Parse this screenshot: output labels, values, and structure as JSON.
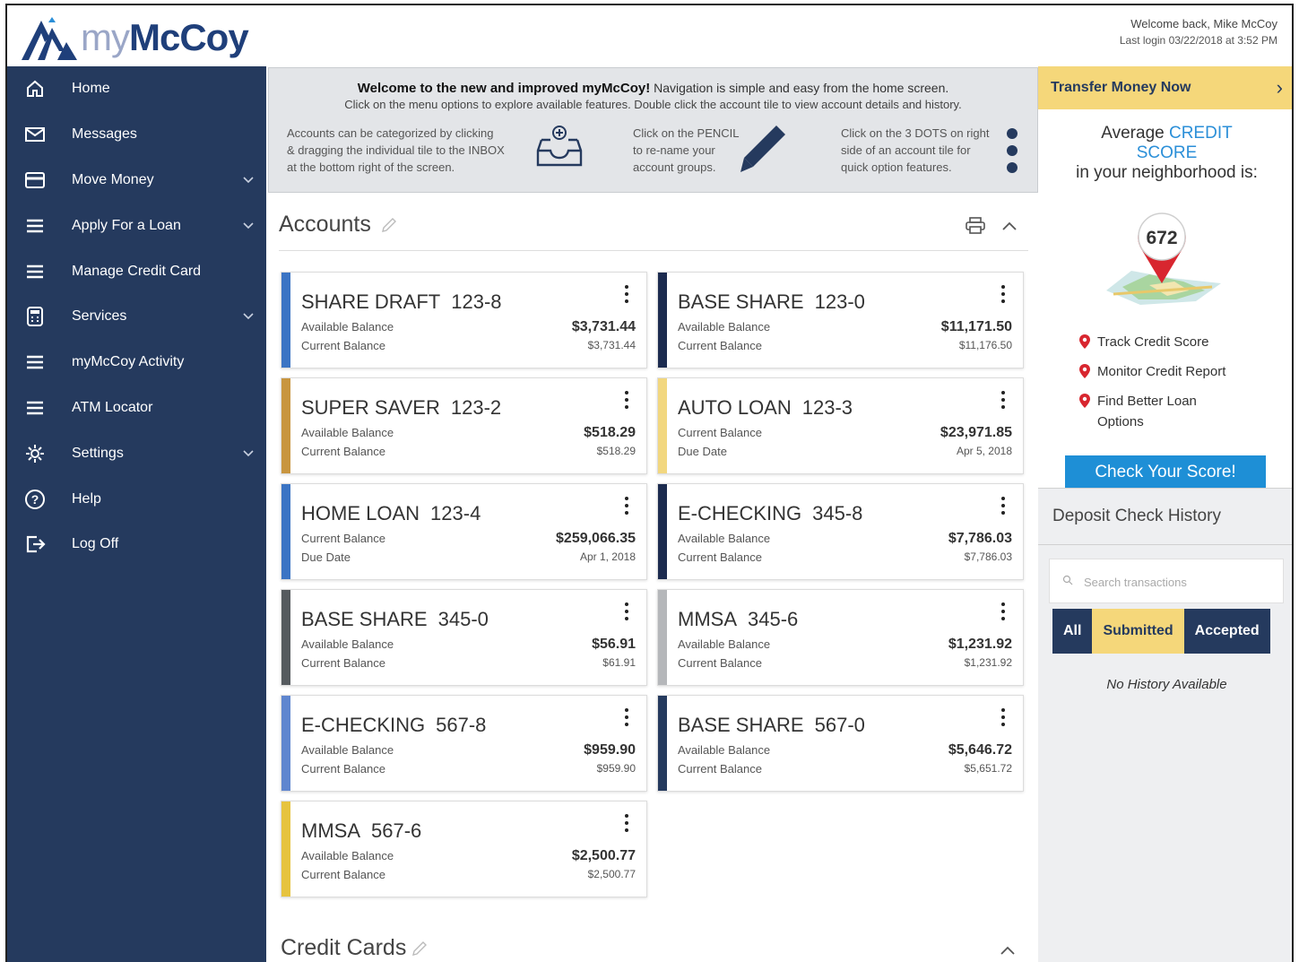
{
  "brand": {
    "logo_my": "my",
    "logo_mc": "McCoy"
  },
  "header": {
    "welcome": "Welcome back, Mike McCoy",
    "last_login": "Last login 03/22/2018 at 3:52 PM"
  },
  "sidebar": {
    "items": [
      {
        "label": "Home",
        "icon": "home-icon",
        "has_chevron": false
      },
      {
        "label": "Messages",
        "icon": "envelope-icon",
        "has_chevron": false
      },
      {
        "label": "Move Money",
        "icon": "card-icon",
        "has_chevron": true
      },
      {
        "label": "Apply For a Loan",
        "icon": "menu-icon",
        "has_chevron": true
      },
      {
        "label": "Manage Credit Card",
        "icon": "menu-icon",
        "has_chevron": false
      },
      {
        "label": "Services",
        "icon": "calculator-icon",
        "has_chevron": true
      },
      {
        "label": "myMcCoy Activity",
        "icon": "menu-icon",
        "has_chevron": false
      },
      {
        "label": "ATM Locator",
        "icon": "menu-icon",
        "has_chevron": false
      },
      {
        "label": "Settings",
        "icon": "gear-icon",
        "has_chevron": true
      },
      {
        "label": "Help",
        "icon": "help-icon",
        "has_chevron": false
      },
      {
        "label": "Log Off",
        "icon": "logout-icon",
        "has_chevron": false
      }
    ]
  },
  "banner": {
    "title_bold": "Welcome to the new and improved myMcCoy!",
    "title_rest": " Navigation is simple and easy from the home screen.",
    "subtitle": "Click on the menu options to explore available features. Double click the account tile to view  account details and history.",
    "tip1": [
      "Accounts can be categorized by clicking",
      "& dragging the individual tile to the INBOX",
      "at the bottom right of the screen."
    ],
    "tip2": [
      "Click on the PENCIL",
      "to re-name your",
      "account groups."
    ],
    "tip3": [
      "Click on the 3 DOTS on right",
      "side of an account tile for",
      "quick option features."
    ]
  },
  "accounts": {
    "title": "Accounts",
    "tiles": [
      {
        "name": "SHARE DRAFT",
        "number": "123-8",
        "label1": "Available Balance",
        "label2": "Current Balance",
        "value1": "$3,731.44",
        "value2": "$3,731.44",
        "color": "#3b74c4"
      },
      {
        "name": "BASE SHARE",
        "number": "123-0",
        "label1": "Available Balance",
        "label2": "Current Balance",
        "value1": "$11,171.50",
        "value2": "$11,176.50",
        "color": "#1c2b4f"
      },
      {
        "name": "SUPER SAVER",
        "number": "123-2",
        "label1": "Available Balance",
        "label2": "Current Balance",
        "value1": "$518.29",
        "value2": "$518.29",
        "color": "#c8953f"
      },
      {
        "name": "AUTO LOAN",
        "number": "123-3",
        "label1": "Current Balance",
        "label2": "Due Date",
        "value1": "$23,971.85",
        "value2": "Apr 5, 2018",
        "color": "#f2d77f"
      },
      {
        "name": "HOME LOAN",
        "number": "123-4",
        "label1": "Current Balance",
        "label2": "Due Date",
        "value1": "$259,066.35",
        "value2": "Apr 1, 2018",
        "color": "#3b74c4"
      },
      {
        "name": "E-CHECKING",
        "number": "345-8",
        "label1": "Available Balance",
        "label2": "Current Balance",
        "value1": "$7,786.03",
        "value2": "$7,786.03",
        "color": "#1c2b4f"
      },
      {
        "name": "BASE SHARE",
        "number": "345-0",
        "label1": "Available Balance",
        "label2": "Current Balance",
        "value1": "$56.91",
        "value2": "$61.91",
        "color": "#555a5e"
      },
      {
        "name": "MMSA",
        "number": "345-6",
        "label1": "Available Balance",
        "label2": "Current Balance",
        "value1": "$1,231.92",
        "value2": "$1,231.92",
        "color": "#b5b7ba"
      },
      {
        "name": "E-CHECKING",
        "number": "567-8",
        "label1": "Available Balance",
        "label2": "Current Balance",
        "value1": "$959.90",
        "value2": "$959.90",
        "color": "#5f86cf"
      },
      {
        "name": "BASE SHARE",
        "number": "567-0",
        "label1": "Available Balance",
        "label2": "Current Balance",
        "value1": "$5,646.72",
        "value2": "$5,651.72",
        "color": "#253a5e"
      },
      {
        "name": "MMSA",
        "number": "567-6",
        "label1": "Available Balance",
        "label2": "Current Balance",
        "value1": "$2,500.77",
        "value2": "$2,500.77",
        "color": "#e6c33f"
      }
    ]
  },
  "credit_cards": {
    "title": "Credit Cards"
  },
  "right": {
    "transfer_label": "Transfer Money Now",
    "credit_pre": "Average ",
    "credit_hl1": "CREDIT",
    "credit_hl2": "SCORE",
    "credit_post": "in your neighborhood is:",
    "score": "672",
    "bullets": [
      "Track Credit Score",
      "Monitor Credit Report",
      "Find Better Loan Options"
    ],
    "check_button": "Check Your Score!",
    "deposit_title": "Deposit Check History",
    "search_placeholder": "Search transactions",
    "filters": [
      "All",
      "Submitted",
      "Accepted"
    ],
    "no_history": "No History Available"
  },
  "colors": {
    "navy": "#253a5e",
    "yellow": "#f5d77a",
    "blue": "#1e8fd6",
    "red_pin": "#d8262f"
  }
}
